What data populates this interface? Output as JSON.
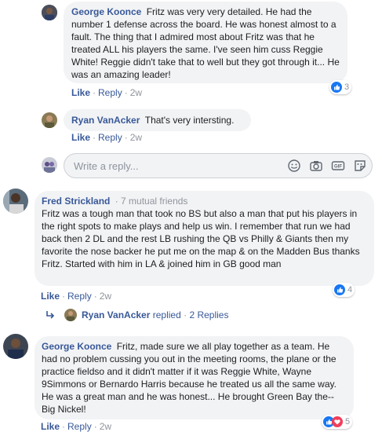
{
  "comments": [
    {
      "author": "George Koonce",
      "text": "Fritz was very very detailed. He had the number 1 defense across the board. He was honest almost to a fault. The thing that I admired most about Fritz was that he treated ALL his players the same. I've seen him cuss Reggie White! Reggie didn't take that to well but they got through it... He was an amazing leader!",
      "like": "Like",
      "reply": "Reply",
      "time": "2w",
      "reaction_count": "3"
    },
    {
      "author": "Ryan VanAcker",
      "text": "That's very intersting.",
      "like": "Like",
      "reply": "Reply",
      "time": "2w"
    },
    {
      "author": "Fred Strickland",
      "meta": "· 7 mutual friends",
      "text": "Fritz was a tough man that took no BS but also a man that put his players in the right spots to make plays and help us win. I remember that run we had back then 2 DL and the rest LB rushing the QB vs Philly & Giants then my favorite the nose backer he put me on the map & on the Madden Bus thanks Fritz. Started with him in LA & joined him in GB good man",
      "like": "Like",
      "reply": "Reply",
      "time": "2w",
      "reaction_count": "4"
    },
    {
      "author": "George Koonce",
      "text": "Fritz, made sure we all play together as a team. He had no problem cussing you out in the meeting rooms, the plane or the practice fieldso and it didn't matter if it was Reggie White, Wayne 9Simmons or Bernardo Harris because he treated us all the same way. He was a great man and he was honest... He brought Green Bay the--Big Nickel!",
      "like": "Like",
      "reply": "Reply",
      "time": "2w",
      "reaction_count": "5"
    }
  ],
  "reply_input": {
    "placeholder": "Write a reply..."
  },
  "replies_summary": {
    "author": "Ryan VanAcker",
    "text": "replied",
    "dot": "·",
    "count_label": "2 Replies"
  },
  "dot": "·",
  "colors": {
    "link": "#385898",
    "bubble": "#f2f3f5",
    "like_blue": "#1877f2",
    "love_red": "#f33e58"
  }
}
